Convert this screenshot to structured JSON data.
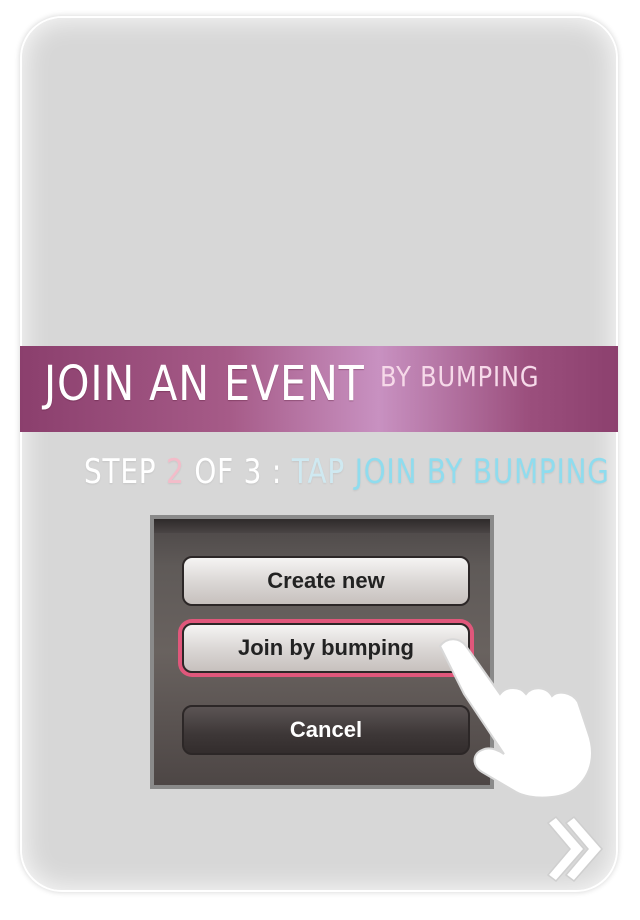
{
  "banner": {
    "title": "JOIN AN EVENT",
    "subtitle": "BY BUMPING"
  },
  "step": {
    "prefix": "STEP",
    "number": "2",
    "of": "OF 3 :",
    "action_prefix": "TAP",
    "action_target": "JOIN BY BUMPING"
  },
  "action_sheet": {
    "create_label": "Create new",
    "join_label": "Join by bumping",
    "cancel_label": "Cancel"
  },
  "icons": {
    "hand": "hand-pointer-icon",
    "next": "double-chevron-right-icon"
  },
  "colors": {
    "banner": "#a65b88",
    "highlight": "#e0577b",
    "step_number": "#f3bcc9",
    "action_text": "#8fdcee"
  }
}
